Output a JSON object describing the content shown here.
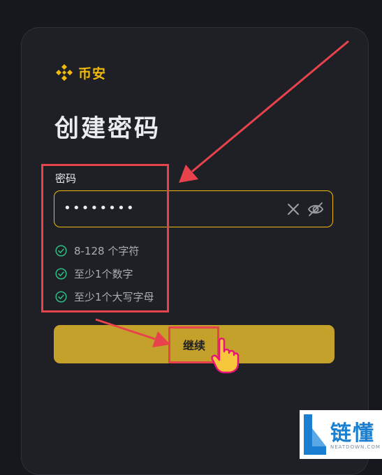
{
  "brand": {
    "name": "币安",
    "color": "#f0b90b"
  },
  "page": {
    "title": "创建密码"
  },
  "password": {
    "label": "密码",
    "value": "••••••••"
  },
  "requirements": [
    {
      "text": "8-128 个字符",
      "met": true
    },
    {
      "text": "至少1个数字",
      "met": true
    },
    {
      "text": "至少1个大写字母",
      "met": true
    }
  ],
  "actions": {
    "continue_label": "继续"
  },
  "watermark": {
    "title": "链懂",
    "subtitle": "NEATDOWN.COM"
  },
  "colors": {
    "accent": "#f0b90b",
    "button": "#c4a12a",
    "check": "#2ebd85",
    "annotation": "#e8434d",
    "background": "#1e2026"
  },
  "icons": [
    "binance-logo-icon",
    "clear-icon",
    "eye-off-icon",
    "check-circle-icon",
    "pointer-hand-icon",
    "annotation-arrow"
  ]
}
